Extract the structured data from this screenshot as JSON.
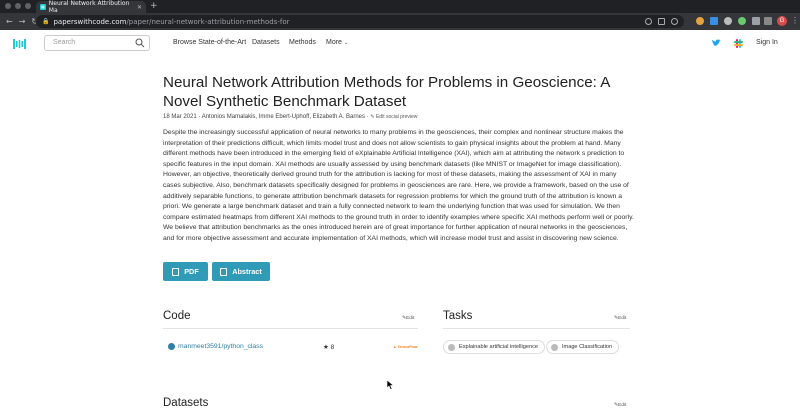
{
  "browser": {
    "tab_title": "Neural Network Attribution Mа",
    "url_host": "paperswithcode.com",
    "url_path": "/paper/neural-network-attribution-methods-for",
    "profile_initial": "G"
  },
  "header": {
    "search_placeholder": "Search",
    "nav": [
      "Browse State-of-the-Art",
      "Datasets",
      "Methods",
      "More"
    ],
    "sign_in": "Sign In"
  },
  "paper": {
    "title": "Neural Network Attribution Methods for Problems in Geoscience: A Novel Synthetic Benchmark Dataset",
    "date": "18 Mar 2021",
    "authors": "Antonios Mamalakis,  Imme Ebert-Uphoff,  Elizabeth A. Barnes",
    "edit_preview": "Edit social preview",
    "abstract": "Despite the increasingly successful application of neural networks to many problems in the geosciences, their complex and nonlinear structure makes the interpretation of their predictions difficult, which limits model trust and does not allow scientists to gain physical insights about the problem at hand. Many different methods have been introduced in the emerging field of eXplainable Artificial Intelligence (XAI), which aim at attributing the network s prediction to specific features in the input domain. XAI methods are usually assessed by using benchmark datasets (like MNIST or ImageNet for image classification). However, an objective, theoretically derived ground truth for the attribution is lacking for most of these datasets, making the assessment of XAI in many cases subjective. Also, benchmark datasets specifically designed for problems in geosciences are rare. Here, we provide a framework, based on the use of additively separable functions, to generate attribution benchmark datasets for regression problems for which the ground truth of the attribution is known a priori. We generate a large benchmark dataset and train a fully connected network to learn the underlying function that was used for simulation. We then compare estimated heatmaps from different XAI methods to the ground truth in order to identify examples where specific XAI methods perform well or poorly. We believe that attribution benchmarks as the ones introduced herein are of great importance for further application of neural networks in the geosciences, and for more objective assessment and accurate implementation of XAI methods, which will increase model trust and assist in discovering new science.",
    "pdf_label": "PDF",
    "abstract_label": "Abstract"
  },
  "code": {
    "heading": "Code",
    "edit": "Edit",
    "repo": "manmeet3591/python_class",
    "stars": "8",
    "framework": "TensorFlow"
  },
  "tasks": {
    "heading": "Tasks",
    "edit": "Edit",
    "items": [
      "Explainable artificial intelligence",
      "Image Classification"
    ]
  },
  "datasets": {
    "heading": "Datasets",
    "edit": "Edit"
  },
  "colors": {
    "accent": "#2f9bb6",
    "link": "#2f7fa6",
    "logo": "#21cbce"
  }
}
